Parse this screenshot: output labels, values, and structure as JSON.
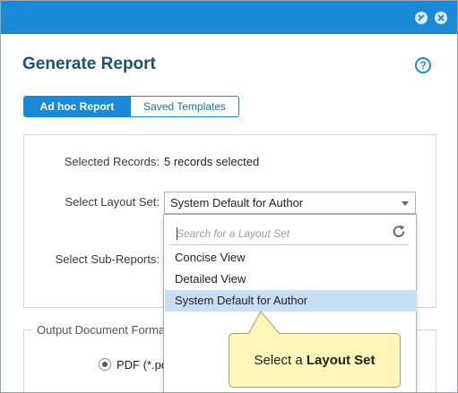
{
  "dialog": {
    "title": "Generate Report",
    "help_symbol": "?",
    "tabs": [
      {
        "label": "Ad hoc Report",
        "active": true
      },
      {
        "label": "Saved Templates",
        "active": false
      }
    ]
  },
  "form": {
    "selected_records_label": "Selected Records:",
    "selected_records_value": "5 records selected",
    "layout_set_label": "Select Layout Set:",
    "layout_set_value": "System Default for Author",
    "sub_reports_label": "Select Sub-Reports:"
  },
  "dropdown": {
    "search_placeholder": "Search for a Layout Set",
    "options": [
      "Concise View",
      "Detailed View",
      "System Default for Author"
    ],
    "highlighted_option": "System Default for Author"
  },
  "output_section": {
    "title": "Output Document Format",
    "pdf_option_label": "PDF (*.pdf)"
  },
  "tooltip": {
    "prefix": "Select a ",
    "bold": "Layout Set"
  },
  "colors": {
    "titlebar": "#1a89d6",
    "accent": "#1a89d6",
    "highlight": "#c7dff4",
    "tooltip_bg": "#fef6b8"
  },
  "icons": {
    "minimize": "minimize-icon",
    "close": "close-icon",
    "help": "help-icon",
    "refresh": "refresh-icon"
  }
}
